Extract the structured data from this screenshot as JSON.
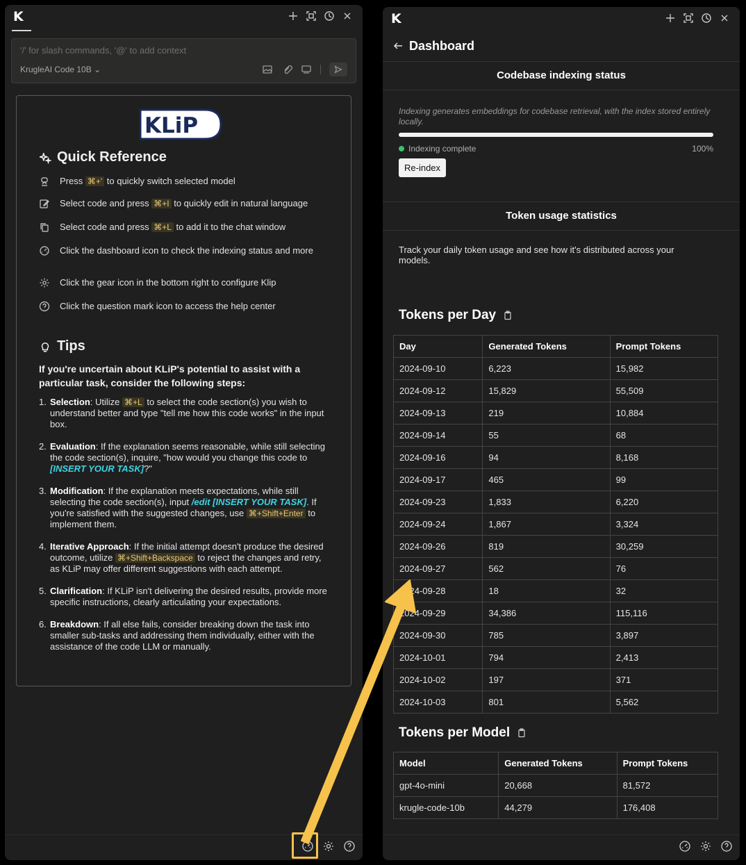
{
  "left": {
    "logo": "K",
    "titlebar_icons": [
      "plus-icon",
      "fullscreen-icon",
      "history-icon",
      "close-icon"
    ],
    "input": {
      "placeholder": "'/' for slash commands, '@' to add context",
      "model": "KrugleAI Code 10B"
    },
    "klip_logo_text": "KLiP",
    "quick_ref_title": "Quick Reference",
    "quick_ref": [
      {
        "pre": "Press ",
        "kbd": "⌘+'",
        "post": " to quickly switch selected model"
      },
      {
        "pre": "Select code and press ",
        "kbd": "⌘+I",
        "post": " to quickly edit in natural language"
      },
      {
        "pre": "Select code and press ",
        "kbd": "⌘+L",
        "post": " to add it to the chat window"
      },
      {
        "pre": "Click the dashboard icon to check the indexing status and more",
        "kbd": "",
        "post": ""
      },
      {
        "pre": "Click the gear icon in the bottom right to configure Klip",
        "kbd": "",
        "post": ""
      },
      {
        "pre": "Click the question mark icon to access the help center",
        "kbd": "",
        "post": ""
      }
    ],
    "tips_title": "Tips",
    "tips_intro": "If you're uncertain about KLiP's potential to assist with a particular task, consider the following steps:",
    "steps": [
      {
        "n": "1.",
        "b": "Selection",
        "t1": ": Utilize ",
        "k": "⌘+L",
        "t2": " to select the code section(s) you wish to understand better and type \"tell me how this code works\" in the input box."
      },
      {
        "n": "2.",
        "b": "Evaluation",
        "t1": ": If the explanation seems reasonable, while still selecting the code section(s), inquire, \"how would you change this code to ",
        "h": "[INSERT YOUR TASK]",
        "t2": "?\""
      },
      {
        "n": "3.",
        "b": "Modification",
        "t1": ": If the explanation meets expectations, while still selecting the code section(s), input ",
        "h": "/edit [INSERT YOUR TASK]",
        "t2": ". If you're satisfied with the suggested changes, use ",
        "k": "⌘+Shift+Enter",
        "t3": " to implement them."
      },
      {
        "n": "4.",
        "b": "Iterative Approach",
        "t1": ": If the initial attempt doesn't produce the desired outcome, utilize ",
        "k": "⌘+Shift+Backspace",
        "t2": " to reject the changes and retry, as KLiP may offer different suggestions with each attempt."
      },
      {
        "n": "5.",
        "b": "Clarification",
        "t1": ": If KLiP isn't delivering the desired results, provide more specific instructions, clearly articulating your expectations."
      },
      {
        "n": "6.",
        "b": "Breakdown",
        "t1": ": If all else fails, consider breaking down the task into smaller sub-tasks and addressing them individually, either with the assistance of the code LLM or manually."
      }
    ],
    "bottom_icons": [
      "dashboard-icon",
      "gear-icon",
      "help-icon"
    ],
    "highlight_color": "#f6c24b"
  },
  "right": {
    "logo": "K",
    "title": "Dashboard",
    "indexing_title": "Codebase indexing status",
    "indexing_desc": "Indexing generates embeddings for codebase retrieval, with the index stored entirely locally.",
    "indexing_status": "Indexing complete",
    "indexing_progress": 1.0,
    "indexing_percent": "100%",
    "reindex_label": "Re-index",
    "token_title": "Token usage statistics",
    "token_desc": "Track your daily token usage and see how it's distributed across your models.",
    "tokens_per_day_title": "Tokens per Day",
    "day_headers": [
      "Day",
      "Generated Tokens",
      "Prompt Tokens"
    ],
    "day_rows": [
      [
        "2024-09-10",
        "6,223",
        "15,982"
      ],
      [
        "2024-09-12",
        "15,829",
        "55,509"
      ],
      [
        "2024-09-13",
        "219",
        "10,884"
      ],
      [
        "2024-09-14",
        "55",
        "68"
      ],
      [
        "2024-09-16",
        "94",
        "8,168"
      ],
      [
        "2024-09-17",
        "465",
        "99"
      ],
      [
        "2024-09-23",
        "1,833",
        "6,220"
      ],
      [
        "2024-09-24",
        "1,867",
        "3,324"
      ],
      [
        "2024-09-26",
        "819",
        "30,259"
      ],
      [
        "2024-09-27",
        "562",
        "76"
      ],
      [
        "2024-09-28",
        "18",
        "32"
      ],
      [
        "2024-09-29",
        "34,386",
        "115,116"
      ],
      [
        "2024-09-30",
        "785",
        "3,897"
      ],
      [
        "2024-10-01",
        "794",
        "2,413"
      ],
      [
        "2024-10-02",
        "197",
        "371"
      ],
      [
        "2024-10-03",
        "801",
        "5,562"
      ]
    ],
    "tokens_per_model_title": "Tokens per Model",
    "model_headers": [
      "Model",
      "Generated Tokens",
      "Prompt Tokens"
    ],
    "model_rows": [
      [
        "gpt-4o-mini",
        "20,668",
        "81,572"
      ],
      [
        "krugle-code-10b",
        "44,279",
        "176,408"
      ]
    ]
  }
}
